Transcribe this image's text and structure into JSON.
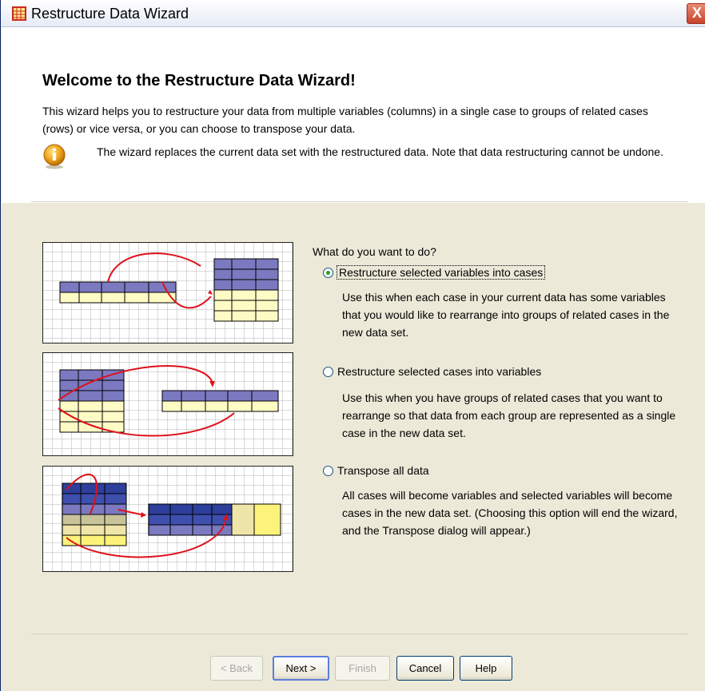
{
  "window": {
    "title": "Restructure Data Wizard",
    "close_glyph": "X"
  },
  "header": {
    "heading": "Welcome to the Restructure Data Wizard!",
    "intro": "This wizard helps you to restructure your data from multiple variables (columns) in a single case to groups of related cases (rows) or vice versa, or you can choose to transpose your data.",
    "note": "The wizard replaces the current data set with the restructured data.  Note that data restructuring cannot be undone.",
    "info_icon": "info-icon"
  },
  "main": {
    "question": "What do you want to do?",
    "options": [
      {
        "label": "Restructure selected variables into cases",
        "checked": true,
        "description": "Use this when each case in your current data has some variables that you would like to rearrange into groups of related cases in the new data set."
      },
      {
        "label": "Restructure selected cases into variables",
        "checked": false,
        "description": "Use this when you have groups of related cases that you want to rearrange so that data from each group are represented as a single case in the new data set."
      },
      {
        "label": "Transpose all data",
        "checked": false,
        "description": "All cases will become variables and selected variables will become cases in the new data set. (Choosing this option will end the wizard, and the Transpose dialog will appear.)"
      }
    ]
  },
  "buttons": {
    "back": "< Back",
    "next": "Next >",
    "finish": "Finish",
    "cancel": "Cancel",
    "help": "Help"
  },
  "colors": {
    "accent": "#316ac5",
    "arrow": "#e0101a",
    "purple_header": "#7b79bf",
    "yellow_cell": "#fffbc5"
  }
}
